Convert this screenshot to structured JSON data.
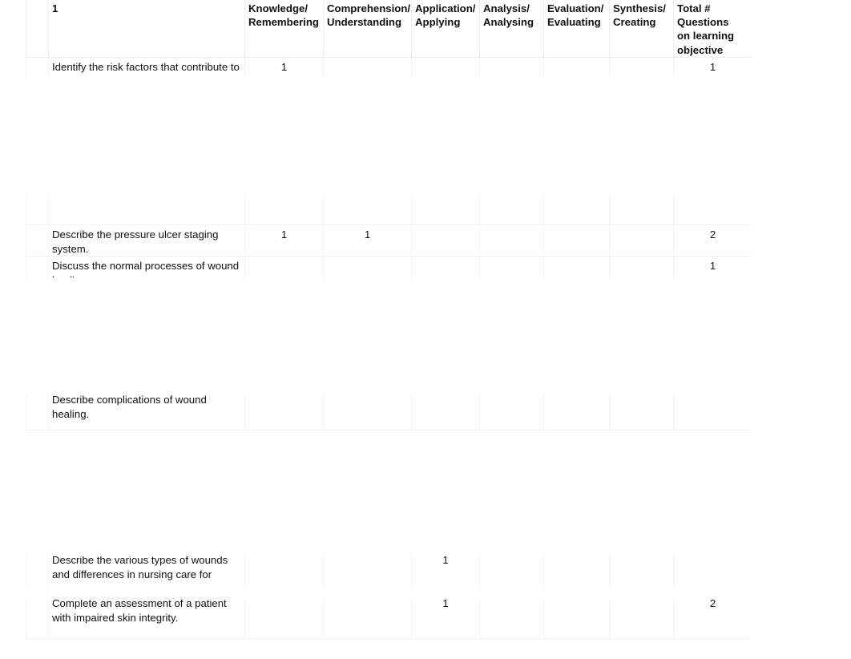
{
  "document": {
    "kind": "spreadsheet-table",
    "title_cell_value": "1"
  },
  "table": {
    "columns": [
      {
        "key": "rownum",
        "label": ""
      },
      {
        "key": "objective",
        "label": ""
      },
      {
        "key": "knowledge",
        "label": "Knowledge/ Remembering"
      },
      {
        "key": "comprehension",
        "label": "Comprehension/ Understanding"
      },
      {
        "key": "application",
        "label": "Application/ Applying"
      },
      {
        "key": "analysis",
        "label": "Analysis/ Analysing"
      },
      {
        "key": "evaluation",
        "label": "Evaluation/ Evaluating"
      },
      {
        "key": "synthesis",
        "label": "Synthesis/ Creating"
      },
      {
        "key": "total",
        "label": "Total # Questions on learning objective"
      }
    ],
    "header": {
      "knowledge_line1": "Knowledge/",
      "knowledge_line2": "Remembering",
      "comprehension_line1": "Comprehension/",
      "comprehension_line2": "Understanding",
      "application_line1": "Application/",
      "application_line2": "Applying",
      "analysis_line1": "Analysis/",
      "analysis_line2": "Analysing",
      "evaluation_line1": "Evaluation/",
      "evaluation_line2": "Evaluating",
      "synthesis_line1": "Synthesis/",
      "synthesis_line2": "Creating",
      "total_line1": "Total #",
      "total_line2": "Questions",
      "total_line3": "on learning",
      "total_line4": "objective",
      "corner_value": "1"
    },
    "rows": [
      {
        "id": "risk-factors",
        "objective": "Identify the risk factors that contribute to pressure ulcer",
        "knowledge": "1",
        "comprehension": "",
        "application": "",
        "analysis": "",
        "evaluation": "",
        "synthesis": "",
        "total": "1"
      },
      {
        "id": "staging-system",
        "objective": "Describe the pressure ulcer staging system.",
        "knowledge": "1",
        "comprehension": "1",
        "application": "",
        "analysis": "",
        "evaluation": "",
        "synthesis": "",
        "total": "2"
      },
      {
        "id": "wound-healing",
        "objective": "Discuss the normal processes of wound healing.",
        "knowledge": "",
        "comprehension": "",
        "application": "",
        "analysis": "",
        "evaluation": "",
        "synthesis": "",
        "total": "1"
      },
      {
        "id": "complications",
        "objective": "Describe complications of wound healing.",
        "knowledge": "",
        "comprehension": "",
        "application": "",
        "analysis": "",
        "evaluation": "",
        "synthesis": "",
        "total": ""
      },
      {
        "id": "wound-types",
        "objective": "Describe the various types of wounds and differences in nursing care for",
        "knowledge": "",
        "comprehension": "",
        "application": "1",
        "analysis": "",
        "evaluation": "",
        "synthesis": "",
        "total": ""
      },
      {
        "id": "assessment",
        "objective": "Complete an assessment of a patient with impaired skin integrity.",
        "knowledge": "",
        "comprehension": "",
        "application": "1",
        "analysis": "",
        "evaluation": "",
        "synthesis": "",
        "total": "2"
      }
    ]
  },
  "colors": {
    "page_background": "#ffffff",
    "gridline": "#f2f2f2",
    "text": "#111111"
  }
}
